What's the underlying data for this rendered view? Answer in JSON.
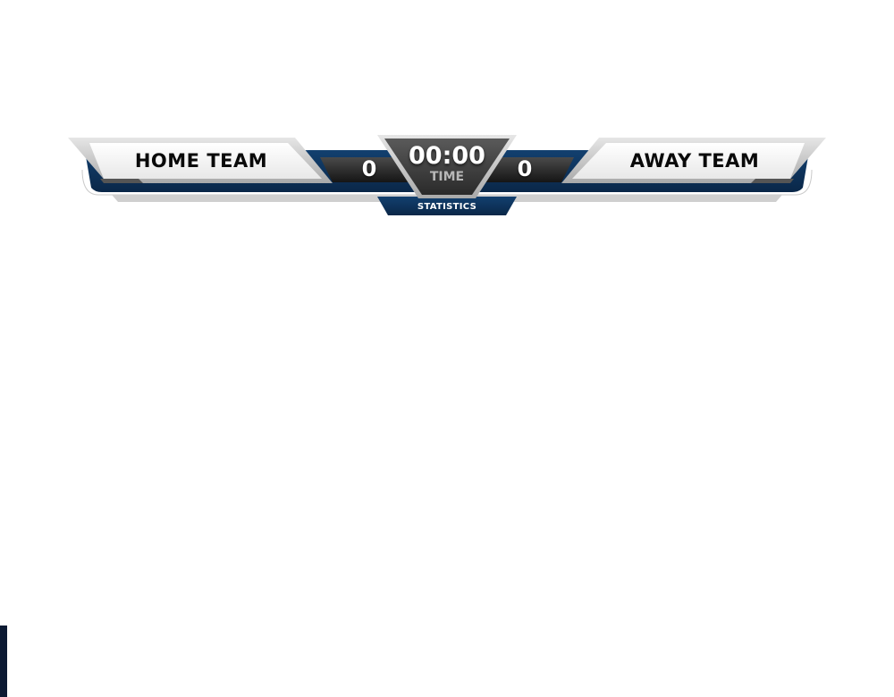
{
  "scoreboard": {
    "home_team": "HOME TEAM",
    "away_team": "AWAY TEAM",
    "home_score": "0",
    "away_score": "0",
    "clock": "00:00",
    "clock_label": "TIME",
    "stats_button": "STATISTICS"
  },
  "colors": {
    "navy": "#0c2f5a",
    "panel_white": "#f4f4f4",
    "clock_dark": "#3a3a3a",
    "score_bar": "#2a2a2a"
  }
}
